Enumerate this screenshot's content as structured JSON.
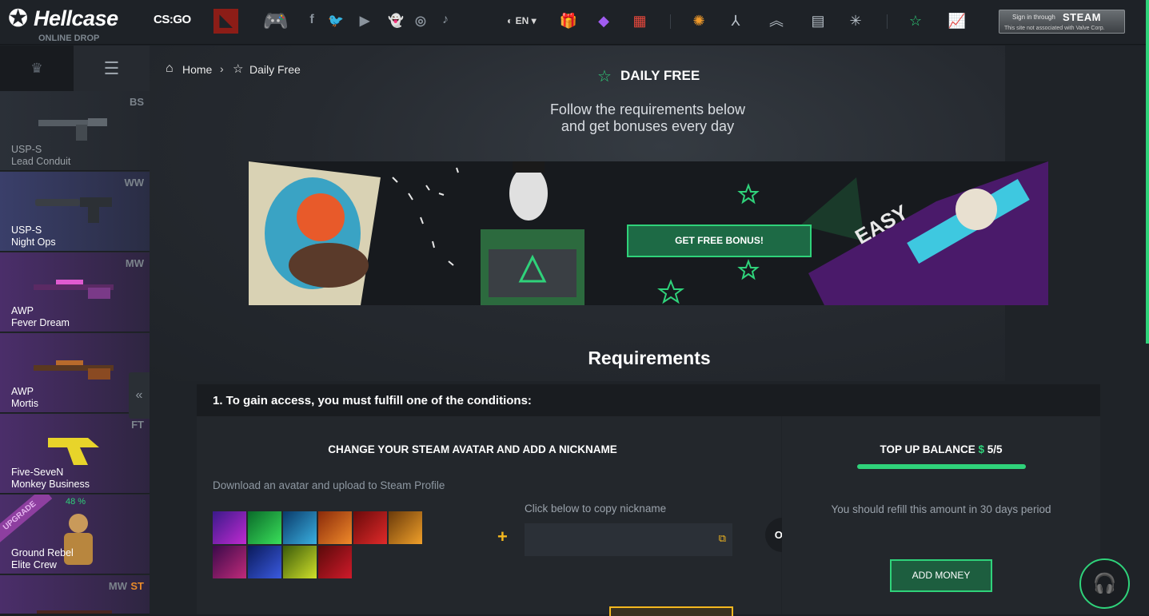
{
  "brand": {
    "name": "Hellcase",
    "tagline": "ONLINE DROP"
  },
  "games": {
    "csgo": "CS:GO",
    "dota": "Dota 2",
    "pad": "Other games"
  },
  "social": [
    "facebook-icon",
    "twitter-icon",
    "youtube-icon",
    "snapchat-icon",
    "instagram-icon",
    "tiktok-icon"
  ],
  "language": "EN",
  "steam_login": {
    "line1": "Sign in through",
    "line2": "STEAM",
    "note": "This site not associated with Valve Corp."
  },
  "sidebar": {
    "drops": [
      {
        "condition": "BS",
        "name": "USP-S",
        "skin": "Lead Conduit",
        "dim": true
      },
      {
        "condition": "WW",
        "name": "USP-S",
        "skin": "Night Ops",
        "dim": false
      },
      {
        "condition": "MW",
        "name": "AWP",
        "skin": "Fever Dream",
        "dim": false
      },
      {
        "condition": "",
        "name": "AWP",
        "skin": "Mortis",
        "dim": false
      },
      {
        "condition": "FT",
        "name": "Five-SeveN",
        "skin": "Monkey Business",
        "dim": false
      },
      {
        "condition": "",
        "name": "Ground Rebel",
        "skin": "Elite Crew",
        "dim": false,
        "upgrade": "UPGRADE",
        "percent": "48 %"
      },
      {
        "condition": "MW",
        "condition_extra": "ST",
        "name": "",
        "skin": "",
        "dim": false
      }
    ],
    "collapse_label": "«"
  },
  "breadcrumb": {
    "home": "Home",
    "current": "Daily Free"
  },
  "page": {
    "title": "DAILY FREE",
    "subtitle_line1": "Follow the requirements below",
    "subtitle_line2": "and get bonuses every day"
  },
  "banner": {
    "button": "GET FREE BONUS!",
    "tag": "EASY"
  },
  "requirements": {
    "title": "Requirements",
    "condition_text": "1. To gain access, you must fulfill one of the conditions:",
    "left": {
      "title": "CHANGE YOUR STEAM AVATAR AND ADD A NICKNAME",
      "download_text": "Download an avatar and upload to Steam Profile",
      "copy_label": "Click below to copy nickname",
      "nickname_value": ""
    },
    "or": "OR",
    "right": {
      "title_prefix": "TOP UP BALANCE",
      "currency": "$",
      "progress_text": "5/5",
      "progress_fraction": 1.0,
      "description": "You should refill this amount in 30 days period",
      "button": "ADD MONEY"
    }
  },
  "colors": {
    "accent": "#2fd27a",
    "gold": "#f4b81f",
    "bg": "#1f2328"
  }
}
